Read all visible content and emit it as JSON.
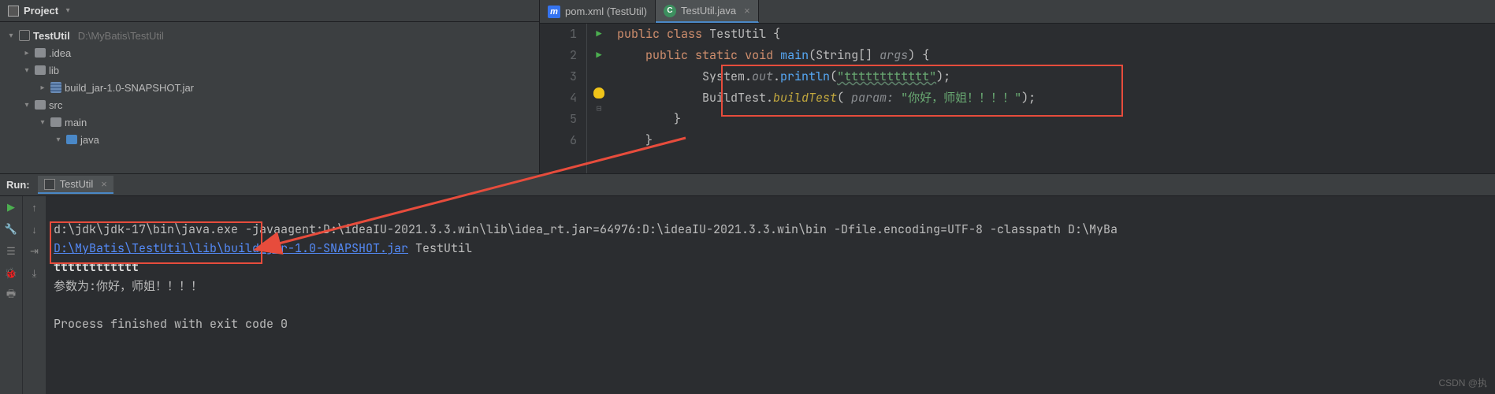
{
  "project_panel": {
    "title": "Project",
    "root": {
      "name": "TestUtil",
      "path": "D:\\MyBatis\\TestUtil"
    },
    "nodes": {
      "idea": ".idea",
      "lib": "lib",
      "jar": "build_jar-1.0-SNAPSHOT.jar",
      "src": "src",
      "main": "main",
      "java": "java"
    }
  },
  "tabs": {
    "pom": "pom.xml (TestUtil)",
    "java": "TestUtil.java"
  },
  "code": {
    "ln1": "1",
    "ln2": "2",
    "ln3": "3",
    "ln4": "4",
    "ln5": "5",
    "ln6": "6",
    "l1_kw1": "public",
    "l1_kw2": "class",
    "l1_cls": "TestUtil",
    "l1_b": " {",
    "l2_kw1": "public",
    "l2_kw2": "static",
    "l2_kw3": "void",
    "l2_m": "main",
    "l2_p1": "(",
    "l2_t": "String",
    "l2_arr": "[] ",
    "l2_a": "args",
    "l2_p2": ") {",
    "l3_pre": "            System.",
    "l3_out": "out",
    "l3_dot": ".",
    "l3_m": "println",
    "l3_p1": "(",
    "l3_s": "\"tttttttttttt\"",
    "l3_p2": ");",
    "l4_pre": "            BuildTest.",
    "l4_m": "buildTest",
    "l4_p1": "( ",
    "l4_param": "param: ",
    "l4_s": "\"你好，师姐！！！！\"",
    "l4_p2": ");",
    "l5": "        }",
    "l6": "    }"
  },
  "run": {
    "label": "Run:",
    "tab": "TestUtil",
    "line1": "d:\\jdk\\jdk-17\\bin\\java.exe -javaagent:D:\\ideaIU-2021.3.3.win\\lib\\idea_rt.jar=64976:D:\\ideaIU-2021.3.3.win\\bin -Dfile.encoding=UTF-8 -classpath D:\\MyBa",
    "link": "D:\\MyBatis\\TestUtil\\lib\\build_jar-1.0-SNAPSHOT.jar",
    "after_link": " TestUtil",
    "out1": "tttttttttttt",
    "out2": "参数为:你好，师姐！！！！",
    "exit": "Process finished with exit code 0"
  },
  "watermark": "CSDN @执"
}
